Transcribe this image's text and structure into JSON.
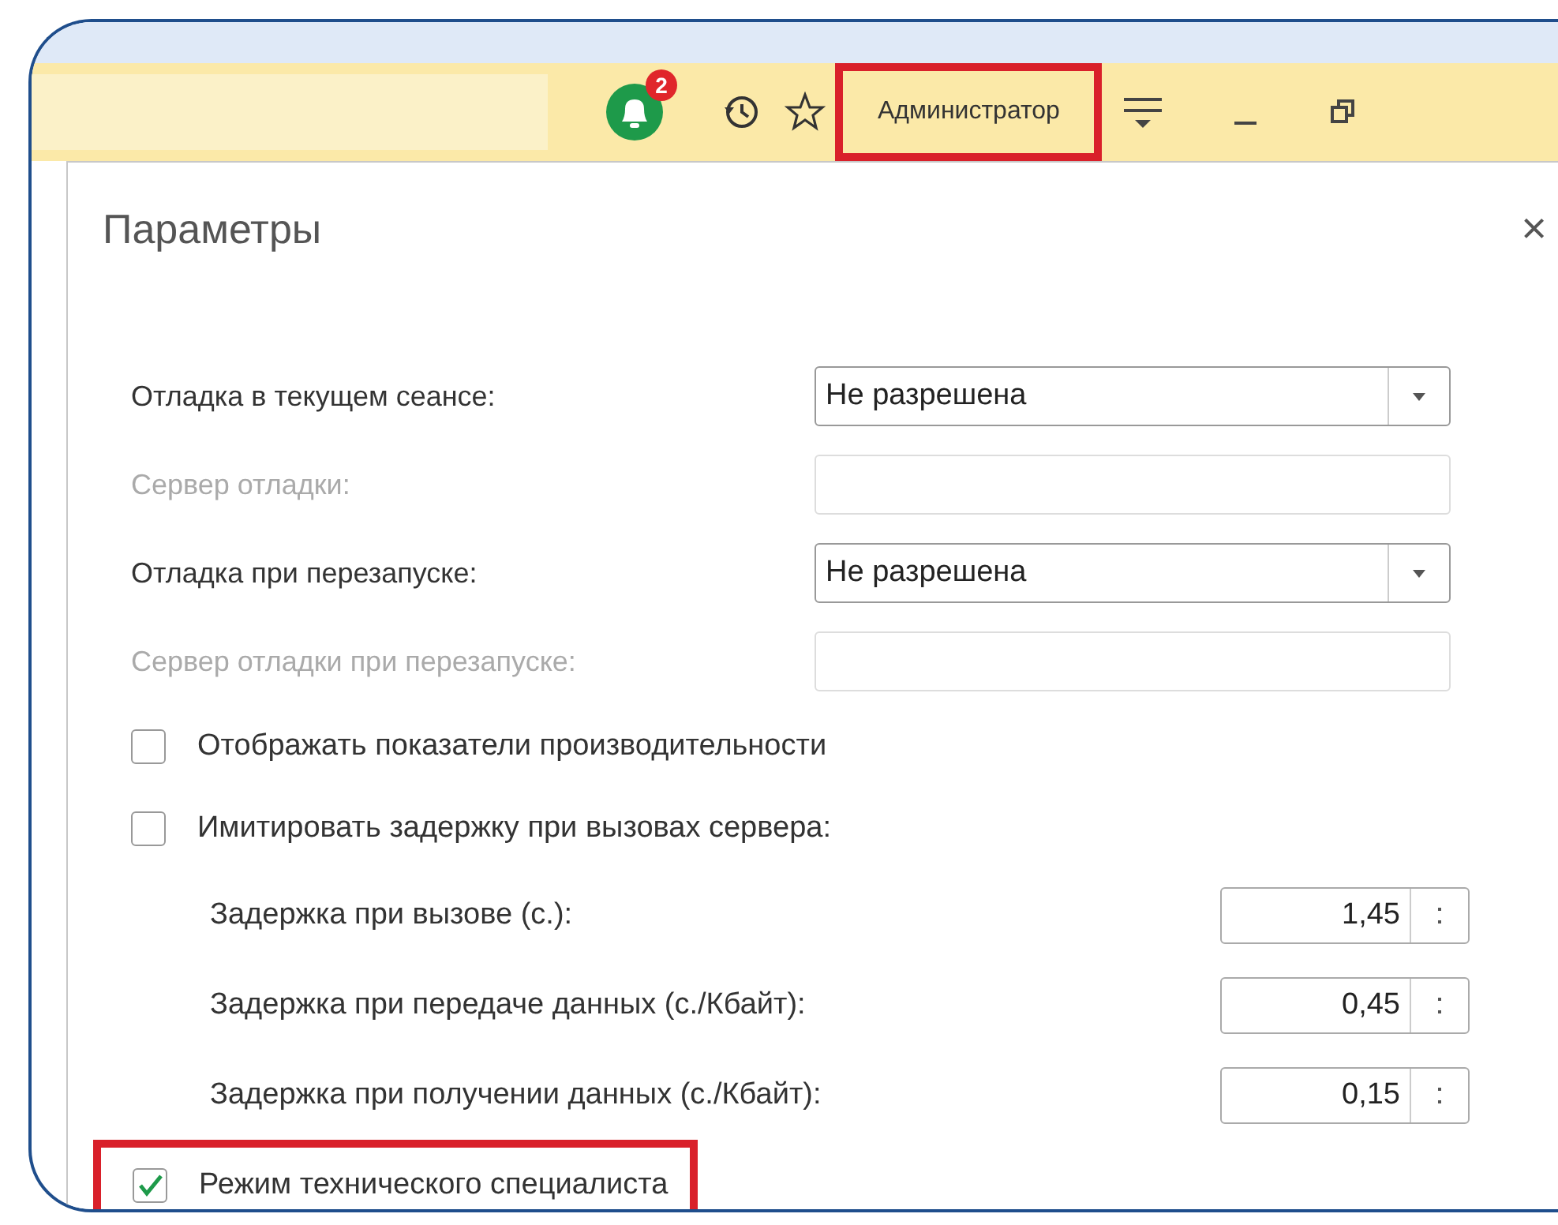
{
  "toolbar": {
    "notification_count": "2",
    "user": {
      "label": "Администратор",
      "highlighted": true
    }
  },
  "dialog": {
    "title": "Параметры",
    "close": "×",
    "fields": [
      {
        "kind": "select",
        "label": "Отладка в текущем сеансе:",
        "value": "Не разрешена",
        "disabled": false
      },
      {
        "kind": "text",
        "label": "Сервер отладки:",
        "disabled": true
      },
      {
        "kind": "select",
        "label": "Отладка при перезапуске:",
        "value": "Не разрешена",
        "disabled": false
      },
      {
        "kind": "text",
        "label": "Сервер отладки при перезапуске:",
        "disabled": true
      }
    ],
    "checkboxes": [
      {
        "label": "Отображать показатели производительности",
        "checked": false
      },
      {
        "label": "Имитировать задержку при вызовах сервера:",
        "checked": false
      }
    ],
    "delays": [
      {
        "label": "Задержка при вызове (с.):",
        "value": "1,45"
      },
      {
        "label": "Задержка при передаче данных (с./Кбайт):",
        "value": "0,45"
      },
      {
        "label": "Задержка при получении данных (с./Кбайт):",
        "value": "0,15"
      }
    ],
    "tech_mode": {
      "label": "Режим технического специалиста",
      "checked": true,
      "highlighted": true
    }
  }
}
